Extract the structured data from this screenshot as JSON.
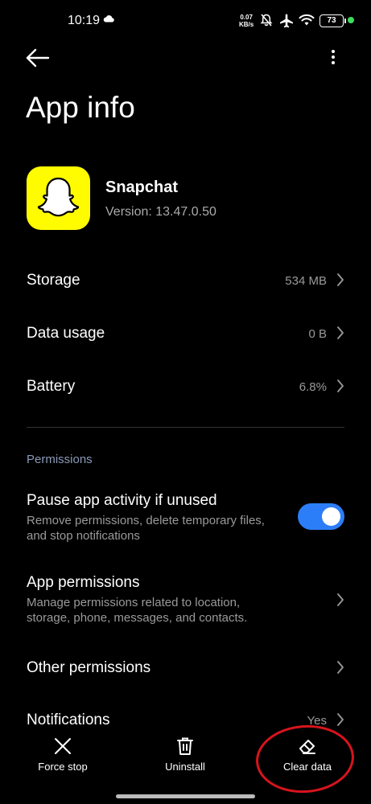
{
  "status_bar": {
    "time": "10:19",
    "net_speed_value": "0.07",
    "net_speed_unit": "KB/s",
    "battery": "73",
    "icons": [
      "cloud-icon",
      "mute-icon",
      "airplane-icon",
      "wifi-icon",
      "battery-icon"
    ]
  },
  "header": {
    "back_icon": "arrow-left-icon",
    "more_icon": "more-vert-icon",
    "title": "App info"
  },
  "app": {
    "name": "Snapchat",
    "version": "Version: 13.47.0.50",
    "icon_color": "#FFFC00"
  },
  "rows": [
    {
      "label": "Storage",
      "value": "534 MB"
    },
    {
      "label": "Data usage",
      "value": "0 B"
    },
    {
      "label": "Battery",
      "value": "6.8%"
    }
  ],
  "permissions": {
    "section_label": "Permissions",
    "pause": {
      "title": "Pause app activity if unused",
      "subtitle_line1": "Remove permissions, delete temporary files,",
      "subtitle_line2": "and stop notifications",
      "enabled": true
    },
    "app_permissions": {
      "title": "App permissions",
      "subtitle_line1": "Manage permissions related to location,",
      "subtitle_line2": "storage, phone, messages, and contacts."
    },
    "other_permissions": {
      "title": "Other permissions"
    },
    "notifications": {
      "title": "Notifications",
      "value": "Yes"
    }
  },
  "bottom_bar": {
    "force_stop": "Force stop",
    "uninstall": "Uninstall",
    "clear_data": "Clear data"
  },
  "colors": {
    "accent_toggle": "#2C7EF8",
    "section_header": "#8A9AB8",
    "annotation": "#D7141C",
    "status_dot": "#3DDC5A"
  }
}
